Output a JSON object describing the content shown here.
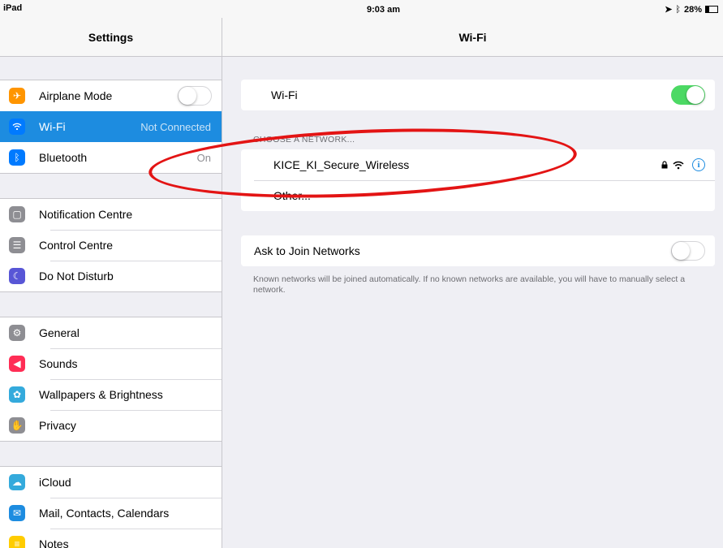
{
  "status_bar": {
    "device": "iPad",
    "time": "9:03 am",
    "battery": "28%",
    "battery_level": 0.28
  },
  "sidebar": {
    "title": "Settings",
    "groups": [
      {
        "items": [
          {
            "label": "Airplane Mode",
            "icon": "airplane-icon",
            "color": "#ff9500",
            "toggle": false
          },
          {
            "label": "Wi-Fi",
            "icon": "wifi-icon",
            "color": "#007aff",
            "value": "Not Connected",
            "selected": true
          },
          {
            "label": "Bluetooth",
            "icon": "bluetooth-icon",
            "color": "#007aff",
            "value": "On"
          }
        ]
      },
      {
        "items": [
          {
            "label": "Notification Centre",
            "icon": "notification-centre-icon",
            "color": "#8e8e93"
          },
          {
            "label": "Control Centre",
            "icon": "control-centre-icon",
            "color": "#8e8e93"
          },
          {
            "label": "Do Not Disturb",
            "icon": "moon-icon",
            "color": "#5856d6"
          }
        ]
      },
      {
        "items": [
          {
            "label": "General",
            "icon": "gear-icon",
            "color": "#8e8e93"
          },
          {
            "label": "Sounds",
            "icon": "speaker-icon",
            "color": "#ff2d55"
          },
          {
            "label": "Wallpapers & Brightness",
            "icon": "wallpaper-flower-icon",
            "color": "#34aadc"
          },
          {
            "label": "Privacy",
            "icon": "hand-icon",
            "color": "#8e8e93"
          }
        ]
      },
      {
        "items": [
          {
            "label": "iCloud",
            "icon": "cloud-icon",
            "color": "#34aadc"
          },
          {
            "label": "Mail, Contacts, Calendars",
            "icon": "mail-icon",
            "color": "#1d8ce0"
          },
          {
            "label": "Notes",
            "icon": "notes-icon",
            "color": "#ffcc00"
          }
        ]
      }
    ]
  },
  "wifi_panel": {
    "title": "Wi-Fi",
    "wifi_label": "Wi-Fi",
    "wifi_on": true,
    "choose_header": "CHOOSE A NETWORK...",
    "networks": [
      {
        "name": "KICE_KI_Secure_Wireless",
        "secured": true
      }
    ],
    "other_label": "Other...",
    "ask_join_label": "Ask to Join Networks",
    "ask_join_on": false,
    "footnote": "Known networks will be joined automatically. If no known networks are available, you will have to manually select a network."
  },
  "colors": {
    "accent": "#1d8ce0",
    "toggle_on": "#4cd964",
    "annotation": "#e31414"
  }
}
